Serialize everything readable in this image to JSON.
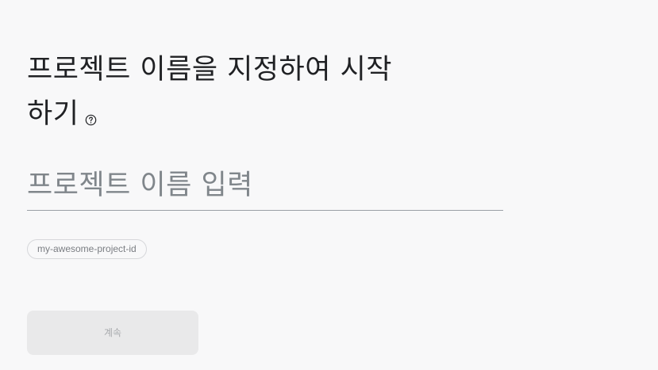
{
  "page": {
    "title": "프로젝트 이름을 지정하여 시작하기",
    "help_icon": "question-circle-icon"
  },
  "form": {
    "project_name_value": "",
    "project_name_placeholder": "프로젝트 이름 입력",
    "project_id_chip": "my-awesome-project-id",
    "continue_label": "계속",
    "continue_enabled": false
  },
  "colors": {
    "background": "#f8f8f9",
    "text_primary": "#202124",
    "placeholder": "#80868b",
    "underline": "#9aa0a6",
    "chip_border": "#d6d7da",
    "button_disabled_bg": "#e9e9ea",
    "button_disabled_text": "#a8aaad"
  }
}
